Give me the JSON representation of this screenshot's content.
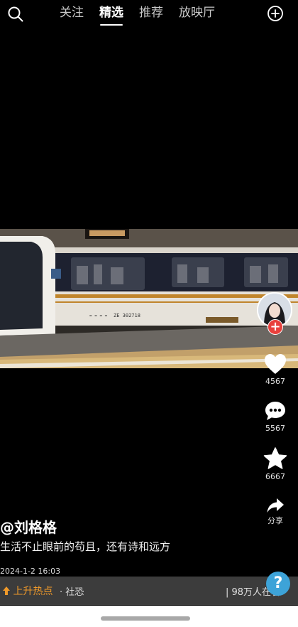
{
  "nav": {
    "tabs": [
      {
        "label": "关注"
      },
      {
        "label": "精选"
      },
      {
        "label": "推荐"
      },
      {
        "label": "放映厅"
      }
    ]
  },
  "video": {
    "train_number": "ZE 302718"
  },
  "actions": {
    "like_count": "4567",
    "comment_count": "5567",
    "favorite_count": "6667",
    "share_label": "分享"
  },
  "post": {
    "author": "@刘格格",
    "description": "生活不止眼前的苟且，还有诗和远方",
    "date": "2024-1-2 16:03"
  },
  "hotbar": {
    "label": "上升热点",
    "tag": "· 社恐",
    "viewers": "| 98万人在看"
  },
  "follow_symbol": "+",
  "help_symbol": "?",
  "colors": {
    "accent_orange": "#f09a2a",
    "follow_red": "#e8413d",
    "help_blue": "#3da3d8"
  }
}
